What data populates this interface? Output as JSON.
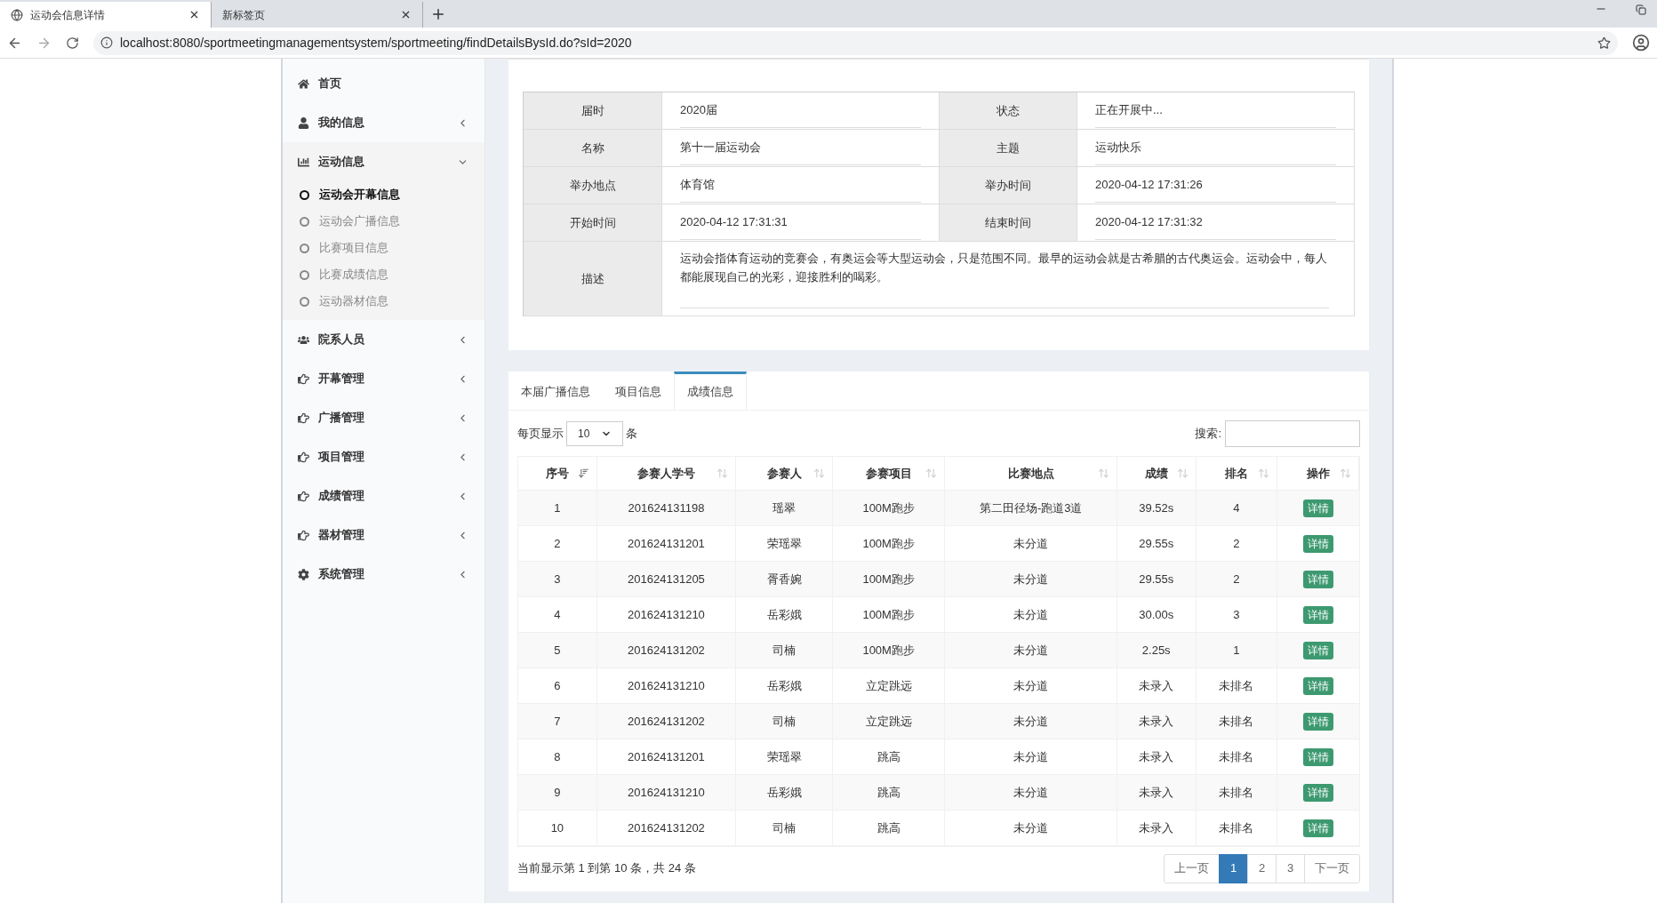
{
  "browser": {
    "tabs": [
      {
        "title": "运动会信息详情",
        "selected": true
      },
      {
        "title": "新标签页",
        "selected": false
      }
    ],
    "url": "localhost:8080/sportmeetingmanagementsystem/sportmeeting/findDetailsBysId.do?sId=2020"
  },
  "sidebar": {
    "items": [
      {
        "label": "首页",
        "kind": "link"
      },
      {
        "label": "我的信息",
        "kind": "menu",
        "expanded": false
      },
      {
        "label": "运动信息",
        "kind": "menu",
        "expanded": true,
        "children": [
          {
            "label": "运动会开幕信息",
            "selected": true
          },
          {
            "label": "运动会广播信息",
            "selected": false
          },
          {
            "label": "比赛项目信息",
            "selected": false
          },
          {
            "label": "比赛成绩信息",
            "selected": false
          },
          {
            "label": "运动器材信息",
            "selected": false
          }
        ]
      },
      {
        "label": "院系人员",
        "kind": "menu",
        "expanded": false
      },
      {
        "label": "开幕管理",
        "kind": "menu",
        "expanded": false
      },
      {
        "label": "广播管理",
        "kind": "menu",
        "expanded": false
      },
      {
        "label": "项目管理",
        "kind": "menu",
        "expanded": false
      },
      {
        "label": "成绩管理",
        "kind": "menu",
        "expanded": false
      },
      {
        "label": "器材管理",
        "kind": "menu",
        "expanded": false
      },
      {
        "label": "系统管理",
        "kind": "menu",
        "expanded": false
      }
    ]
  },
  "details": {
    "fields": [
      {
        "label": "届时",
        "value": "2020届"
      },
      {
        "label": "状态",
        "value": "正在开展中..."
      },
      {
        "label": "名称",
        "value": "第十一届运动会"
      },
      {
        "label": "主题",
        "value": "运动快乐"
      },
      {
        "label": "举办地点",
        "value": "体育馆"
      },
      {
        "label": "举办时间",
        "value": "2020-04-12 17:31:26"
      },
      {
        "label": "开始时间",
        "value": "2020-04-12 17:31:31"
      },
      {
        "label": "结束时间",
        "value": "2020-04-12 17:31:32"
      }
    ],
    "description": {
      "label": "描述",
      "value": "运动会指体育运动的竞赛会，有奥运会等大型运动会，只是范围不同。最早的运动会就是古希腊的古代奥运会。运动会中，每人都能展现自己的光彩，迎接胜利的喝彩。"
    }
  },
  "tabs": [
    {
      "label": "本届广播信息",
      "selected": false
    },
    {
      "label": "项目信息",
      "selected": false
    },
    {
      "label": "成绩信息",
      "selected": true
    }
  ],
  "length_control": {
    "prefix": "每页显示",
    "value": "10",
    "suffix": "条"
  },
  "search": {
    "label": "搜索:"
  },
  "table": {
    "columns": [
      {
        "label": "序号",
        "sorted": true
      },
      {
        "label": "参赛人学号",
        "sorted": false
      },
      {
        "label": "参赛人",
        "sorted": false
      },
      {
        "label": "参赛项目",
        "sorted": false
      },
      {
        "label": "比赛地点",
        "sorted": false
      },
      {
        "label": "成绩",
        "sorted": false
      },
      {
        "label": "排名",
        "sorted": false
      },
      {
        "label": "操作",
        "sorted": false
      }
    ],
    "rows": [
      {
        "cells": [
          "1",
          "201624131198",
          "瑶翠",
          "100M跑步",
          "第二田径场-跑道3道",
          "39.52s",
          "4"
        ],
        "action": "详情"
      },
      {
        "cells": [
          "2",
          "201624131201",
          "荣瑶翠",
          "100M跑步",
          "未分道",
          "29.55s",
          "2"
        ],
        "action": "详情"
      },
      {
        "cells": [
          "3",
          "201624131205",
          "胥香婉",
          "100M跑步",
          "未分道",
          "29.55s",
          "2"
        ],
        "action": "详情"
      },
      {
        "cells": [
          "4",
          "201624131210",
          "岳彩娥",
          "100M跑步",
          "未分道",
          "30.00s",
          "3"
        ],
        "action": "详情"
      },
      {
        "cells": [
          "5",
          "201624131202",
          "司楠",
          "100M跑步",
          "未分道",
          "2.25s",
          "1"
        ],
        "action": "详情"
      },
      {
        "cells": [
          "6",
          "201624131210",
          "岳彩娥",
          "立定跳远",
          "未分道",
          "未录入",
          "未排名"
        ],
        "action": "详情"
      },
      {
        "cells": [
          "7",
          "201624131202",
          "司楠",
          "立定跳远",
          "未分道",
          "未录入",
          "未排名"
        ],
        "action": "详情"
      },
      {
        "cells": [
          "8",
          "201624131201",
          "荣瑶翠",
          "跳高",
          "未分道",
          "未录入",
          "未排名"
        ],
        "action": "详情"
      },
      {
        "cells": [
          "9",
          "201624131210",
          "岳彩娥",
          "跳高",
          "未分道",
          "未录入",
          "未排名"
        ],
        "action": "详情"
      },
      {
        "cells": [
          "10",
          "201624131202",
          "司楠",
          "跳高",
          "未分道",
          "未录入",
          "未排名"
        ],
        "action": "详情"
      }
    ]
  },
  "table_info": "当前显示第 1 到第 10 条，共 24 条",
  "pagination": [
    {
      "label": "上一页",
      "selected": false
    },
    {
      "label": "1",
      "selected": true
    },
    {
      "label": "2",
      "selected": false
    },
    {
      "label": "3",
      "selected": false
    },
    {
      "label": "下一页",
      "selected": false
    }
  ]
}
